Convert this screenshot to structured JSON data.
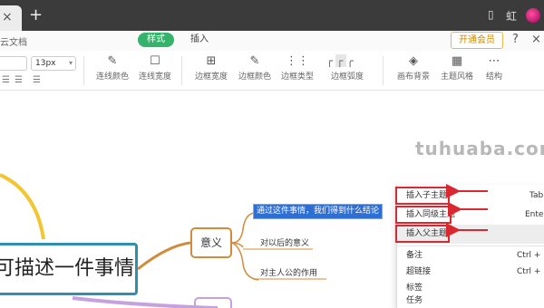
{
  "tab": {
    "close": "×",
    "new": "+"
  },
  "titlebar_right": {
    "icon_a": "▯",
    "icon_b": "☷",
    "user_char": "虹"
  },
  "doc": {
    "title": "云文档"
  },
  "modes": {
    "style": "样式",
    "insert": "插入"
  },
  "header_actions": {
    "vip": "开通会员",
    "help": "?",
    "close": "×"
  },
  "toolbar": {
    "font_size": "13px",
    "tools": [
      {
        "label": "连线颜色",
        "icon": "pen-line-icon"
      },
      {
        "label": "连线宽度",
        "icon": "line-width-icon"
      },
      {
        "label": "边框宽度",
        "icon": "border-width-icon"
      },
      {
        "label": "边框颜色",
        "icon": "border-color-icon"
      },
      {
        "label": "边框类型",
        "icon": "border-type-icon"
      },
      {
        "label": "边框弧度",
        "icon": "border-radius-icon"
      },
      {
        "label": "画布背景",
        "icon": "canvas-background-icon"
      },
      {
        "label": "主题风格",
        "icon": "theme-style-icon"
      },
      {
        "label": "结构",
        "icon": "structure-icon"
      }
    ]
  },
  "canvas": {
    "watermark": "tuhuaba.com",
    "central_topic": "可描述一件事情",
    "branch": "意义",
    "selected_child": "通过这件事情，我们得到什么结论",
    "child_2": "对以后的意义",
    "child_3": "对主人公的作用"
  },
  "context_menu": {
    "items": [
      {
        "label": "插入子主题",
        "shortcut": "Tab"
      },
      {
        "label": "插入同级主题",
        "shortcut": "Enter"
      },
      {
        "label": "插入父主题",
        "shortcut": ""
      },
      {
        "label": "备注",
        "shortcut": "Ctrl + R"
      },
      {
        "label": "超链接",
        "shortcut": "Ctrl + K"
      },
      {
        "label": "标签",
        "shortcut": ""
      },
      {
        "label": "任务",
        "shortcut": ""
      }
    ]
  },
  "colors": {
    "accent_green": "#35b36b",
    "annotation_red": "#d9282f",
    "central_border": "#2f8fae",
    "branch_orange": "#d28b3b",
    "selection_blue": "#2d6fd2"
  }
}
